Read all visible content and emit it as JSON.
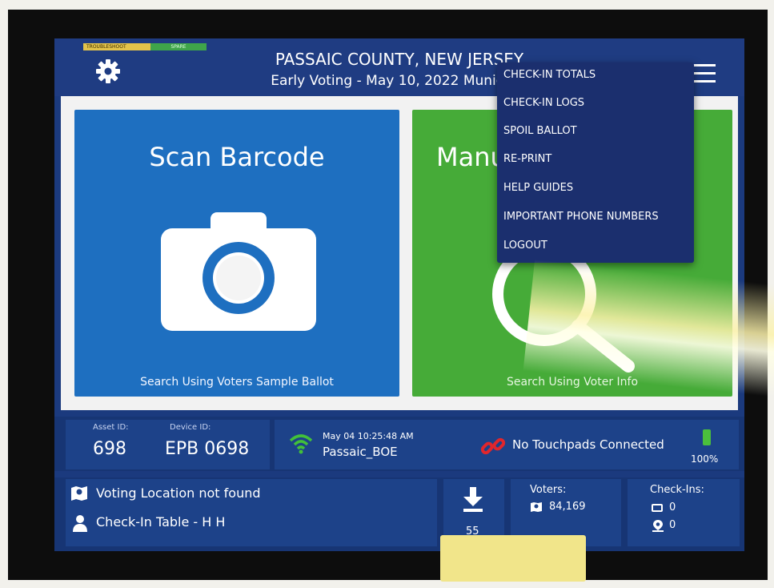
{
  "header": {
    "flag_troubleshoot": "TROUBLESHOOT",
    "flag_spare": "SPARE",
    "county": "PASSAIC COUNTY, NEW JERSEY",
    "election": "Early Voting - May 10, 2022 Municipal"
  },
  "tiles": {
    "scan": {
      "title": "Scan Barcode",
      "subtitle": "Search Using Voters Sample Ballot"
    },
    "manual": {
      "title": "Manual Search",
      "subtitle": "Search Using Voter Info"
    }
  },
  "menu": {
    "items": [
      {
        "label": "CHECK-IN TOTALS"
      },
      {
        "label": "CHECK-IN LOGS"
      },
      {
        "label": "SPOIL BALLOT"
      },
      {
        "label": "RE-PRINT"
      },
      {
        "label": "HELP GUIDES"
      },
      {
        "label": "IMPORTANT PHONE NUMBERS"
      },
      {
        "label": "LOGOUT"
      }
    ]
  },
  "status": {
    "asset_id_label": "Asset ID:",
    "asset_id": "698",
    "device_id_label": "Device ID:",
    "device_id": "EPB 0698",
    "sync_time": "May 04  10:25:48 AM",
    "network": "Passaic_BOE",
    "touchpads": "No Touchpads Connected",
    "battery": "100%"
  },
  "footer": {
    "location": "Voting Location not found",
    "table": "Check-In Table - H H",
    "downloads": "55",
    "voters_label": "Voters:",
    "voters_count": "84,169",
    "checkins_label": "Check-Ins:",
    "checkins_device": "0",
    "checkins_location": "0"
  },
  "colors": {
    "screen_bg": "#1b3a7e",
    "scan_tile": "#1e6fc0",
    "manual_tile": "#46ab38",
    "menu_bg": "#1b2f6e",
    "wifi": "#42c03a",
    "broken_link": "#e1262c"
  },
  "icons": {
    "settings": "gear-icon",
    "menu": "hamburger-icon",
    "camera": "camera-icon",
    "search": "magnifier-icon",
    "wifi": "wifi-icon",
    "touchpad": "broken-link-icon",
    "battery": "battery-icon",
    "location": "map-pin-icon",
    "user": "person-icon",
    "download": "download-icon"
  }
}
